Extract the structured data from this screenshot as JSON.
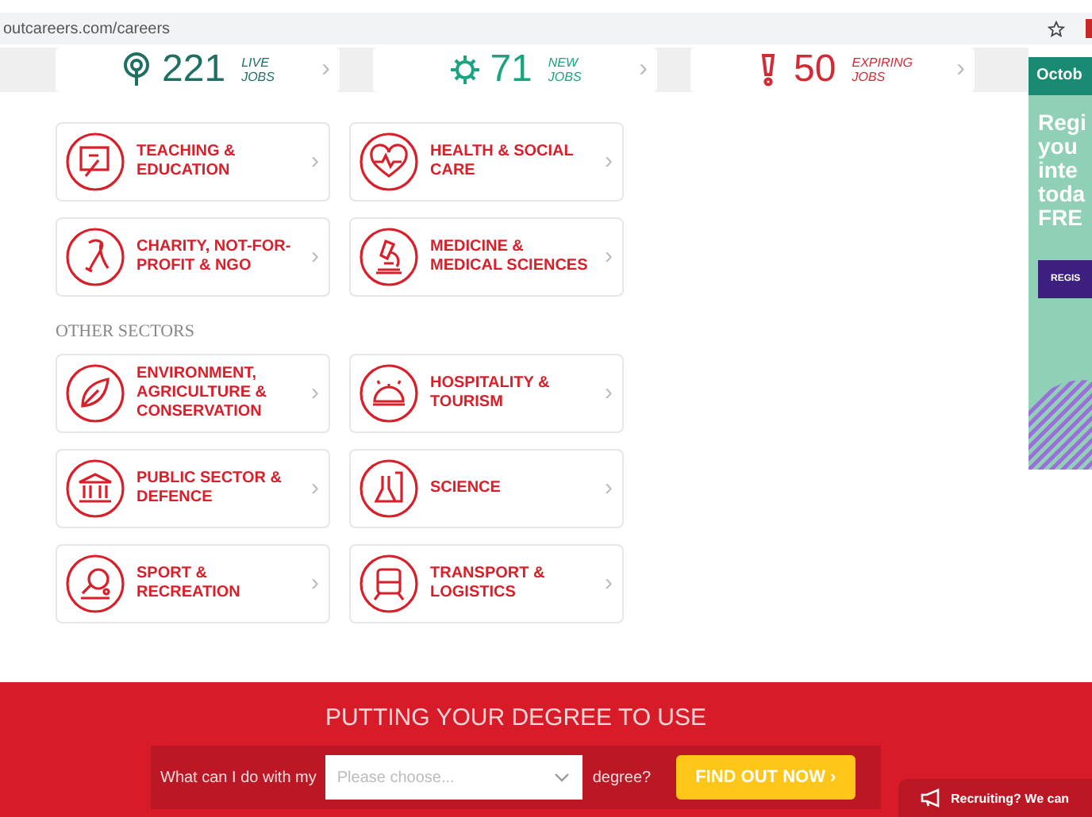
{
  "browser": {
    "address": "outcareers.com/careers"
  },
  "stats": [
    {
      "count": "221",
      "label_top": "LIVE",
      "label_bottom": "JOBS",
      "color": "#1f6f62",
      "chevron": "›"
    },
    {
      "count": "71",
      "label_top": "NEW",
      "label_bottom": "JOBS",
      "color": "#1aa37f",
      "chevron": "›"
    },
    {
      "count": "50",
      "label_top": "EXPIRING",
      "label_bottom": "JOBS",
      "color": "#d42a35",
      "chevron": "›"
    }
  ],
  "sectors_top": [
    {
      "label": "TEACHING & EDUCATION",
      "chevron": "›"
    },
    {
      "label": "HEALTH & SOCIAL CARE",
      "chevron": "›"
    },
    {
      "label": "CHARITY, NOT-FOR-PROFIT & NGO",
      "chevron": "›"
    },
    {
      "label": "MEDICINE & MEDICAL SCIENCES",
      "chevron": "›"
    }
  ],
  "other_sectors": {
    "heading": "OTHER SECTORS",
    "items": [
      {
        "label": "ENVIRONMENT, AGRICULTURE & CONSERVATION",
        "chevron": "›"
      },
      {
        "label": "HOSPITALITY & TOURISM",
        "chevron": "›"
      },
      {
        "label": "PUBLIC SECTOR & DEFENCE",
        "chevron": "›"
      },
      {
        "label": "SCIENCE",
        "chevron": "›"
      },
      {
        "label": "SPORT & RECREATION",
        "chevron": "›"
      },
      {
        "label": "TRANSPORT & LOGISTICS",
        "chevron": "›"
      }
    ]
  },
  "ad": {
    "header": "Octob",
    "lines": [
      "Regi",
      "you",
      "inte",
      "toda",
      "FRE"
    ],
    "button": "REGIS"
  },
  "degree": {
    "heading": "PUTTING YOUR DEGREE TO USE",
    "prefix": "What can I do with my",
    "placeholder": "Please choose...",
    "suffix": "degree?",
    "button": "FIND OUT NOW ›"
  },
  "recruiting": {
    "label": "Recruiting? We can"
  }
}
